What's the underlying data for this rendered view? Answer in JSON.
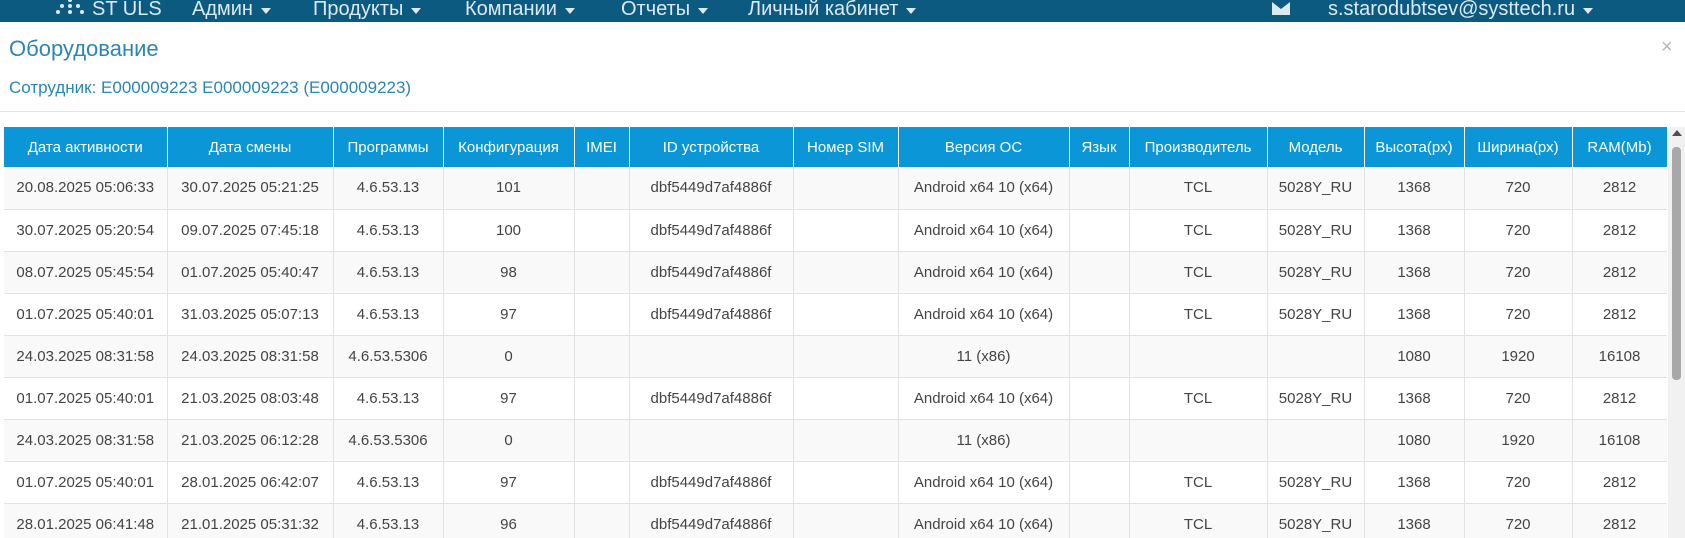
{
  "navbar": {
    "brand": "ST ULS",
    "menu": [
      {
        "label": "Админ"
      },
      {
        "label": "Продукты"
      },
      {
        "label": "Компании"
      },
      {
        "label": "Отчеты"
      },
      {
        "label": "Личный кабинет"
      }
    ],
    "user_email": "s.starodubtsev@systtech.ru",
    "icons": {
      "logo": "dots-logo-icon",
      "mail": "envelope-icon",
      "dropdown": "caret-down-icon"
    },
    "background": "#0c5a80"
  },
  "modal": {
    "title": "Оборудование",
    "close": "×",
    "employee": "Сотрудник: E000009223 E000009223 (E000009223)"
  },
  "table": {
    "header_color": "#0b96d8",
    "columns": [
      "Дата активности",
      "Дата смены",
      "Программы",
      "Конфигурация",
      "IMEI",
      "ID устройства",
      "Номер SIM",
      "Версия ОС",
      "Язык",
      "Производитель",
      "Модель",
      "Высота(px)",
      "Ширина(px)",
      "RAM(Mb)"
    ],
    "rows": [
      [
        "20.08.2025 05:06:33",
        "30.07.2025 05:21:25",
        "4.6.53.13",
        "101",
        "",
        "dbf5449d7af4886f",
        "",
        "Android x64 10 (x64)",
        "",
        "TCL",
        "5028Y_RU",
        "1368",
        "720",
        "2812"
      ],
      [
        "30.07.2025 05:20:54",
        "09.07.2025 07:45:18",
        "4.6.53.13",
        "100",
        "",
        "dbf5449d7af4886f",
        "",
        "Android x64 10 (x64)",
        "",
        "TCL",
        "5028Y_RU",
        "1368",
        "720",
        "2812"
      ],
      [
        "08.07.2025 05:45:54",
        "01.07.2025 05:40:47",
        "4.6.53.13",
        "98",
        "",
        "dbf5449d7af4886f",
        "",
        "Android x64 10 (x64)",
        "",
        "TCL",
        "5028Y_RU",
        "1368",
        "720",
        "2812"
      ],
      [
        "01.07.2025 05:40:01",
        "31.03.2025 05:07:13",
        "4.6.53.13",
        "97",
        "",
        "dbf5449d7af4886f",
        "",
        "Android x64 10 (x64)",
        "",
        "TCL",
        "5028Y_RU",
        "1368",
        "720",
        "2812"
      ],
      [
        "24.03.2025 08:31:58",
        "24.03.2025 08:31:58",
        "4.6.53.5306",
        "0",
        "",
        "",
        "",
        "11 (x86)",
        "",
        "",
        "",
        "1080",
        "1920",
        "16108"
      ],
      [
        "01.07.2025 05:40:01",
        "21.03.2025 08:03:48",
        "4.6.53.13",
        "97",
        "",
        "dbf5449d7af4886f",
        "",
        "Android x64 10 (x64)",
        "",
        "TCL",
        "5028Y_RU",
        "1368",
        "720",
        "2812"
      ],
      [
        "24.03.2025 08:31:58",
        "21.03.2025 06:12:28",
        "4.6.53.5306",
        "0",
        "",
        "",
        "",
        "11 (x86)",
        "",
        "",
        "",
        "1080",
        "1920",
        "16108"
      ],
      [
        "01.07.2025 05:40:01",
        "28.01.2025 06:42:07",
        "4.6.53.13",
        "97",
        "",
        "dbf5449d7af4886f",
        "",
        "Android x64 10 (x64)",
        "",
        "TCL",
        "5028Y_RU",
        "1368",
        "720",
        "2812"
      ],
      [
        "28.01.2025 06:41:48",
        "21.01.2025 05:31:32",
        "4.6.53.13",
        "96",
        "",
        "dbf5449d7af4886f",
        "",
        "Android x64 10 (x64)",
        "",
        "TCL",
        "5028Y_RU",
        "1368",
        "720",
        "2812"
      ]
    ]
  }
}
